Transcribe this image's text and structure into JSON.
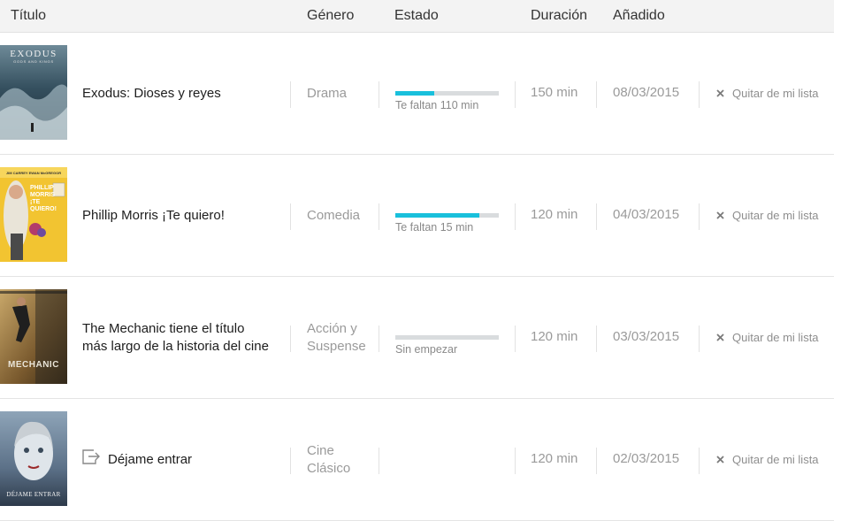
{
  "columns": {
    "title": "Título",
    "genre": "Género",
    "status": "Estado",
    "duration": "Duración",
    "added": "Añadido"
  },
  "remove_label": "Quitar de mi lista",
  "colors": {
    "accent": "#19c0dc",
    "track": "#d9dcde"
  },
  "rows": [
    {
      "title": "Exodus: Dioses y reyes",
      "genre": "Drama",
      "progress": 0.38,
      "status_text": "Te faltan 110 min",
      "duration": "150 min",
      "added": "08/03/2015",
      "poster_text": "EXODUS",
      "poster_subtext": "GODS AND KINGS"
    },
    {
      "title": "Phillip Morris ¡Te quiero!",
      "genre": "Comedia",
      "progress": 0.81,
      "status_text": "Te faltan 15 min",
      "duration": "120 min",
      "added": "04/03/2015",
      "poster_text": "PHILLIP MORRIS ¡TE QUIERO!",
      "poster_top": "JIM CARREY    EWAN McGREGOR"
    },
    {
      "title": "The Mechanic tiene el título más largo de la historia del cine",
      "genre": "Acción y Suspense",
      "progress": 0,
      "status_text": "Sin empezar",
      "duration": "120 min",
      "added": "03/03/2015",
      "poster_text": "MECHANIC"
    },
    {
      "title": "Déjame entrar",
      "genre": "Cine Clásico",
      "duration": "120 min",
      "added": "02/03/2015",
      "poster_text": "DÉJAME ENTRAR"
    }
  ]
}
